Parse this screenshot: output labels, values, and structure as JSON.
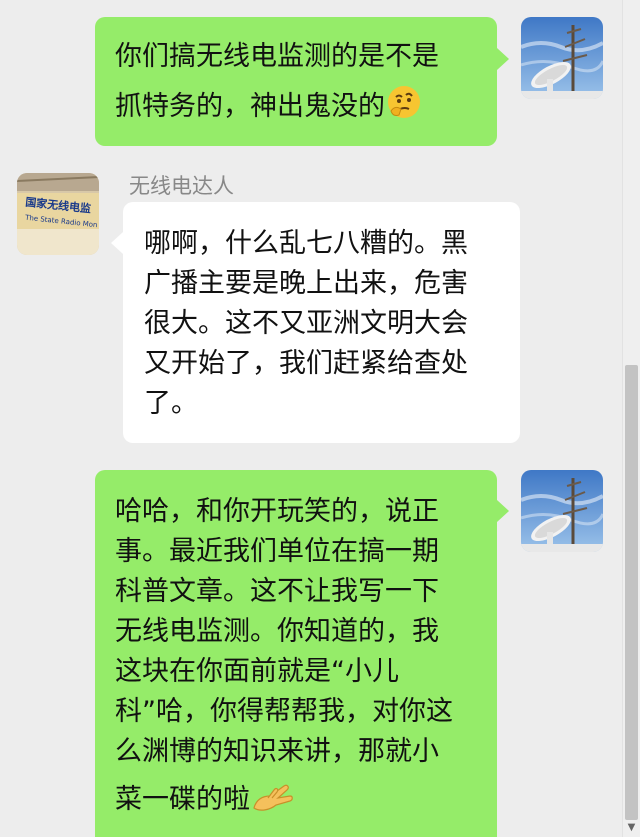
{
  "messages": [
    {
      "side": "right",
      "lines": [
        "你们搞无线电监测的是不是",
        "抓特务的，神出鬼没的"
      ],
      "emoji": "thinking-face"
    },
    {
      "side": "left",
      "sender": "无线电达人",
      "lines": [
        "哪啊，什么乱七八糟的。黑",
        "广播主要是晚上出来，危害",
        "很大。这不又亚洲文明大会",
        "又开始了，我们赶紧给查处",
        "了。"
      ]
    },
    {
      "side": "right",
      "lines": [
        "哈哈，和你开玩笑的，说正",
        "事。最近我们单位在搞一期",
        "科普文章。这不让我写一下",
        "无线电监测。你知道的，我",
        "这块在你面前就是“小儿",
        "科”哈，你得帮帮我，对你这",
        "么渊博的知识来讲，那就小",
        "菜一碟的啦"
      ],
      "emoji": "pinching-hand"
    }
  ],
  "avatars": {
    "self_icon": "satellite-dish-avatar",
    "contact_icon": "building-sign-avatar",
    "contact_sign_text": "国家无线电监",
    "contact_sign_subtext": "The State Radio Mon"
  },
  "colors": {
    "sent_bubble": "#95ec69",
    "received_bubble": "#ffffff",
    "background": "#ededed"
  }
}
